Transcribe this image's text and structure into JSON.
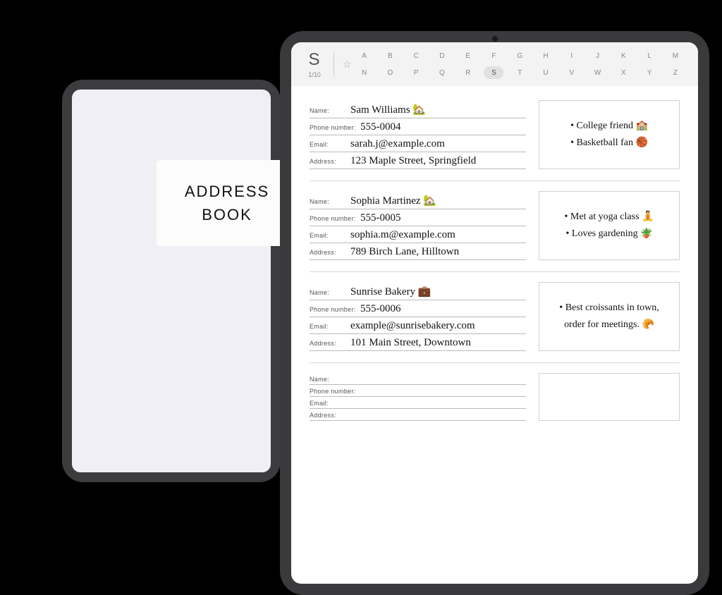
{
  "cover": {
    "line1": "ADDRESS",
    "line2": "BOOK"
  },
  "alpha": {
    "current_letter": "S",
    "page_indicator": "1/10",
    "star": "☆",
    "row1": [
      "A",
      "B",
      "C",
      "D",
      "E",
      "F",
      "G",
      "H",
      "I",
      "J",
      "K",
      "L",
      "M"
    ],
    "row2": [
      "N",
      "O",
      "P",
      "Q",
      "R",
      "S",
      "T",
      "U",
      "V",
      "W",
      "X",
      "Y",
      "Z"
    ],
    "selected": "S"
  },
  "labels": {
    "name": "Name:",
    "phone": "Phone number:",
    "email": "Email:",
    "address": "Address:"
  },
  "contacts": [
    {
      "name": "Sam Williams 🏡",
      "phone": "555-0004",
      "email": "sarah.j@example.com",
      "address": "123 Maple Street, Springfield",
      "notes": [
        "• College friend 🏫",
        "• Basketball fan 🏀"
      ]
    },
    {
      "name": "Sophia Martinez 🏡",
      "phone": "555-0005",
      "email": "sophia.m@example.com",
      "address": "789 Birch Lane, Hilltown",
      "notes": [
        "• Met at yoga class 🧘",
        "• Loves gardening 🪴"
      ]
    },
    {
      "name": "Sunrise Bakery 💼",
      "phone": "555-0006",
      "email": "example@sunrisebakery.com",
      "address": "101 Main Street, Downtown",
      "notes": [
        "• Best croissants in town, order for meetings. 🥐"
      ]
    },
    {
      "name": "",
      "phone": "",
      "email": "",
      "address": "",
      "notes": []
    }
  ]
}
